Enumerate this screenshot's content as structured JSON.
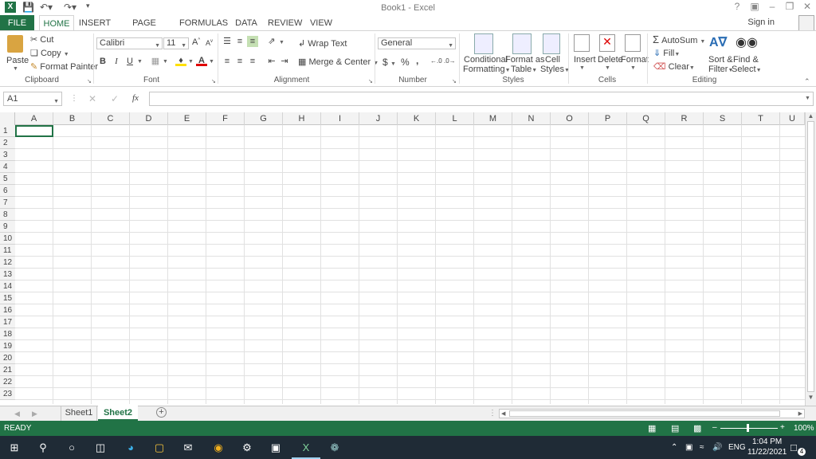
{
  "window": {
    "title": "Book1 - Excel"
  },
  "qat": {
    "save": "save-icon",
    "undo": "undo-icon",
    "redo": "redo-icon"
  },
  "tabs": {
    "file": "FILE",
    "home": "HOME",
    "insert": "INSERT",
    "page_layout": "PAGE LAYOUT",
    "formulas": "FORMULAS",
    "data": "DATA",
    "review": "REVIEW",
    "view": "VIEW"
  },
  "account": {
    "signin": "Sign in"
  },
  "clipboard": {
    "paste": "Paste",
    "cut": "Cut",
    "copy": "Copy",
    "format_painter": "Format Painter",
    "group": "Clipboard"
  },
  "font": {
    "name": "Calibri",
    "size": "11",
    "bold": "B",
    "italic": "I",
    "underline": "U",
    "group": "Font"
  },
  "alignment": {
    "wrap": "Wrap Text",
    "merge": "Merge & Center",
    "group": "Alignment"
  },
  "number": {
    "format": "General",
    "currency": "$",
    "percent": "%",
    "comma": ",",
    "group": "Number"
  },
  "styles": {
    "conditional_1": "Conditional",
    "conditional_2": "Formatting",
    "table_1": "Format as",
    "table_2": "Table",
    "cell_1": "Cell",
    "cell_2": "Styles",
    "group": "Styles"
  },
  "cells": {
    "insert": "Insert",
    "delete": "Delete",
    "format": "Format",
    "group": "Cells"
  },
  "editing": {
    "autosum": "AutoSum",
    "fill": "Fill",
    "clear": "Clear",
    "sort_1": "Sort &",
    "sort_2": "Filter",
    "find_1": "Find &",
    "find_2": "Select",
    "group": "Editing"
  },
  "formula_bar": {
    "name_box": "A1",
    "fx": "fx",
    "value": ""
  },
  "grid": {
    "columns": [
      "A",
      "B",
      "C",
      "D",
      "E",
      "F",
      "G",
      "H",
      "I",
      "J",
      "K",
      "L",
      "M",
      "N",
      "O",
      "P",
      "Q",
      "R",
      "S",
      "T",
      "U"
    ],
    "rows": [
      "1",
      "2",
      "3",
      "4",
      "5",
      "6",
      "7",
      "8",
      "9",
      "10",
      "11",
      "12",
      "13",
      "14",
      "15",
      "16",
      "17",
      "18",
      "19",
      "20",
      "21",
      "22",
      "23"
    ]
  },
  "sheets": [
    "Sheet1",
    "Sheet2"
  ],
  "active_sheet": "Sheet2",
  "status": {
    "mode": "READY",
    "zoom": "100%"
  },
  "taskbar": {
    "lang": "ENG",
    "time": "1:04 PM",
    "date": "11/22/2021",
    "notifications": "4"
  }
}
